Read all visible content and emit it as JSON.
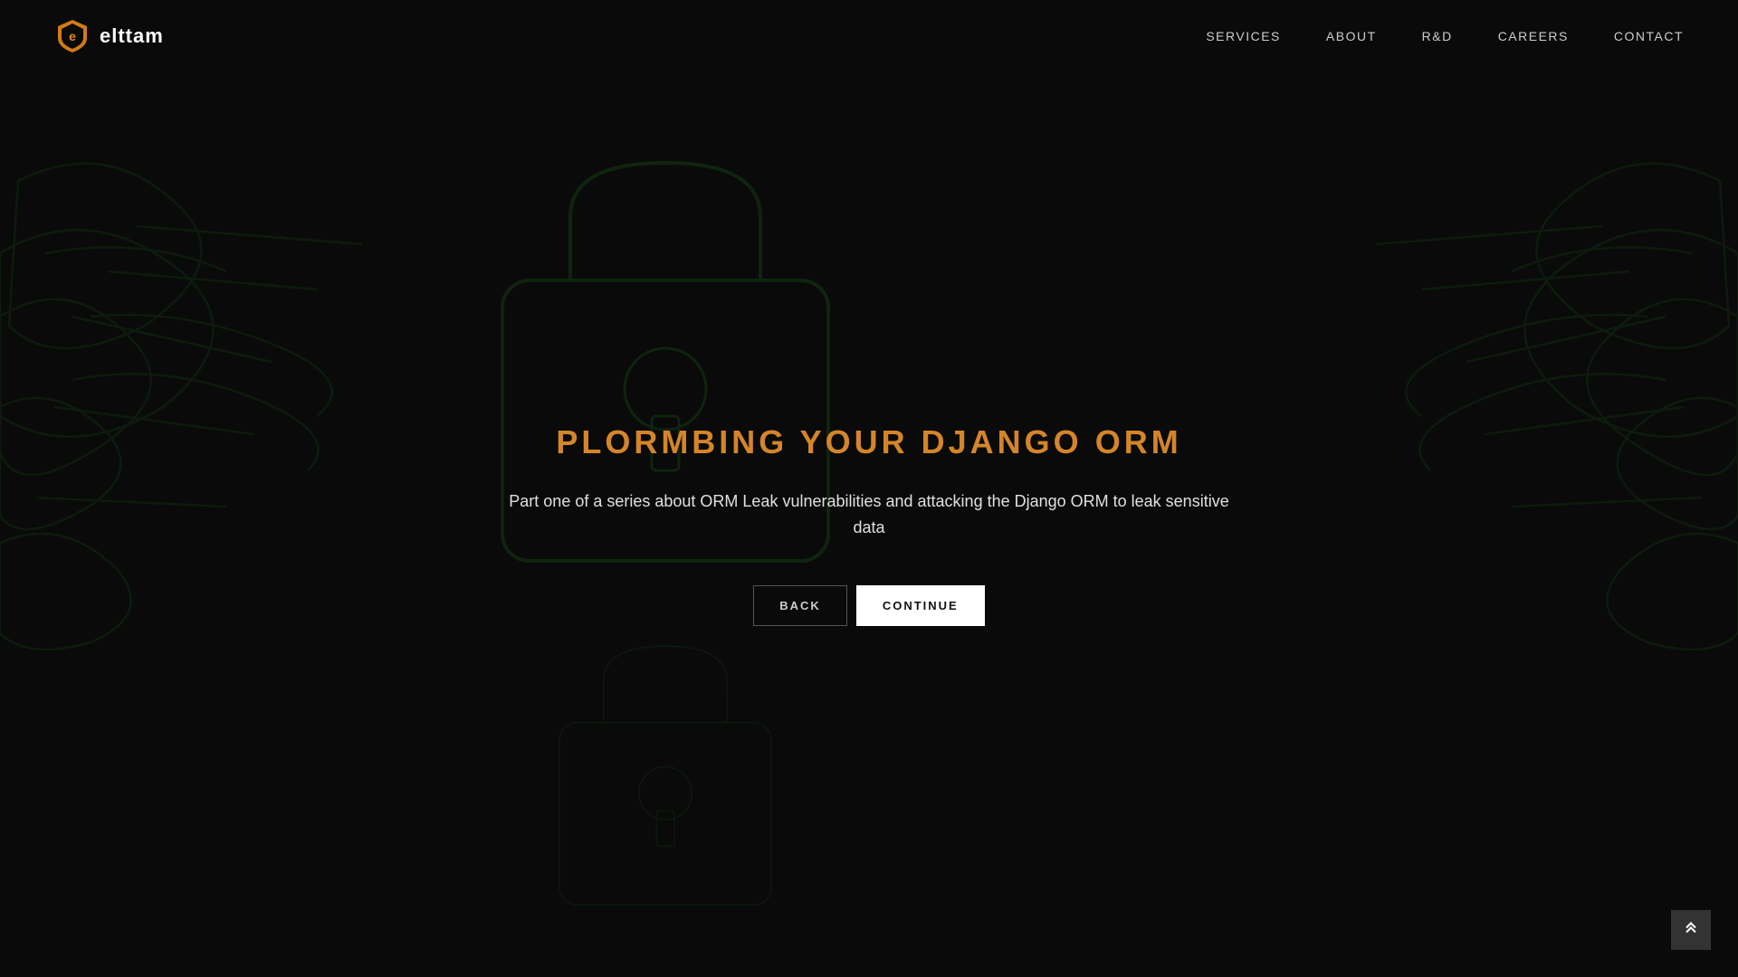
{
  "logo": {
    "text": "elttam",
    "icon_label": "elttam-shield-icon"
  },
  "nav": {
    "items": [
      {
        "label": "SERVICES",
        "href": "#"
      },
      {
        "label": "ABOUT",
        "href": "#"
      },
      {
        "label": "R&D",
        "href": "#"
      },
      {
        "label": "CAREERS",
        "href": "#"
      },
      {
        "label": "CONTACT",
        "href": "#"
      }
    ]
  },
  "main": {
    "title": "PLORMBING YOUR DJANGO ORM",
    "subtitle": "Part one of a series about ORM Leak vulnerabilities and attacking the Django ORM to leak sensitive data",
    "back_label": "BACK",
    "continue_label": "CONTINUE"
  },
  "scroll_top": {
    "label": "↑"
  },
  "colors": {
    "accent": "#d4852a",
    "bg": "#0a0a0a",
    "nav_text": "#cccccc",
    "body_text": "#e0e0e0",
    "green_deco": "#1a4a1a"
  }
}
